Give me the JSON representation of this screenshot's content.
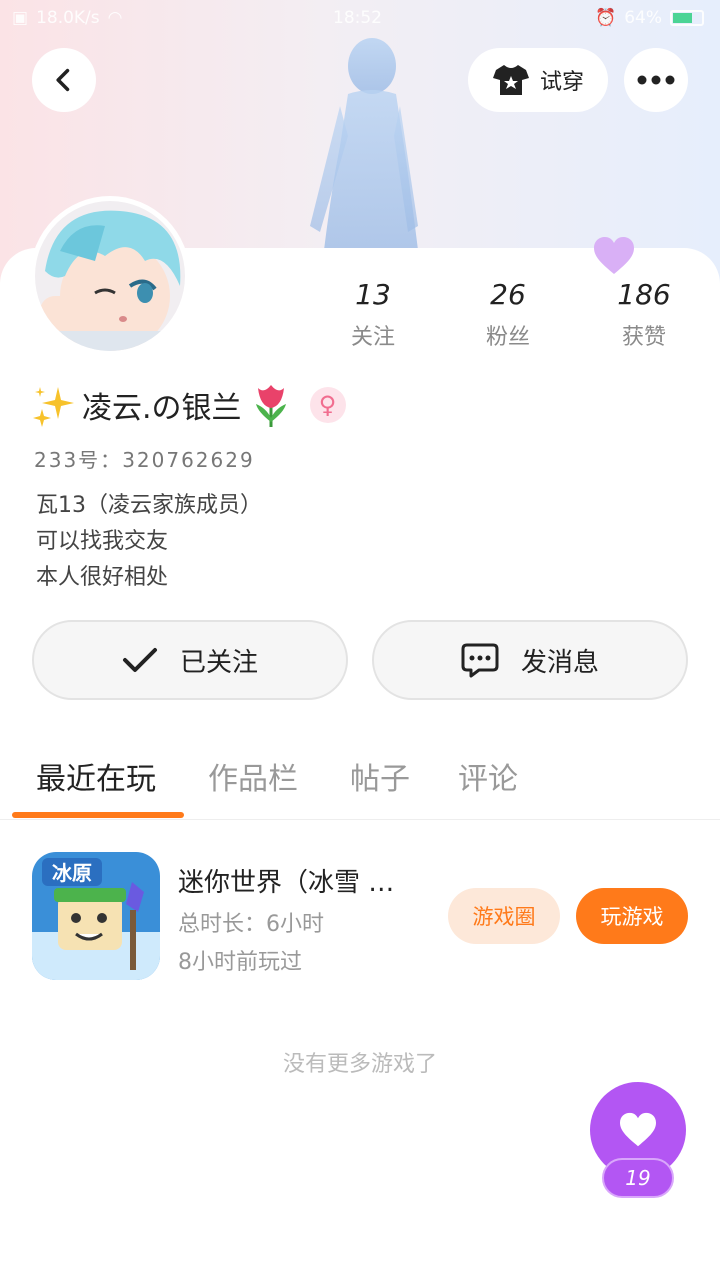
{
  "status_bar": {
    "network_speed": "18.0K/s",
    "time": "18:52",
    "battery": "64%",
    "battery_level": 0.64,
    "icons": [
      "sim-icon",
      "wifi-icon",
      "alarm-icon",
      "battery-icon"
    ]
  },
  "header": {
    "back_icon": "chevron-left-icon",
    "tryon_label": "试穿",
    "tryon_icon": "tshirt-icon",
    "more_icon": "more-horizontal-icon"
  },
  "profile": {
    "name": "凌云.の银兰",
    "gender_icon": "female-icon",
    "id_label": "233号：",
    "id_value": "320762629",
    "bio": [
      "瓦13（凌云家族成员）",
      "可以找我交友",
      "本人很好相处"
    ]
  },
  "stats": [
    {
      "value": "13",
      "label": "关注"
    },
    {
      "value": "26",
      "label": "粉丝"
    },
    {
      "value": "186",
      "label": "获赞"
    }
  ],
  "actions": {
    "follow_label": "已关注",
    "message_label": "发消息"
  },
  "tabs": [
    {
      "label": "最近在玩",
      "active": true
    },
    {
      "label": "作品栏",
      "active": false
    },
    {
      "label": "帖子",
      "active": false
    },
    {
      "label": "评论",
      "active": false
    }
  ],
  "game": {
    "name": "迷你世界（冰雪 …",
    "duration": "总时长：6小时",
    "last_played": "8小时前玩过",
    "icon_badge": "冰原",
    "circle_label": "游戏圈",
    "play_label": "玩游戏"
  },
  "footer": {
    "no_more": "没有更多游戏了"
  },
  "like": {
    "count": "19"
  },
  "colors": {
    "accent_orange": "#ff7a1a",
    "like_purple": "#b356f3",
    "gender_pink": "#f16d8f"
  }
}
